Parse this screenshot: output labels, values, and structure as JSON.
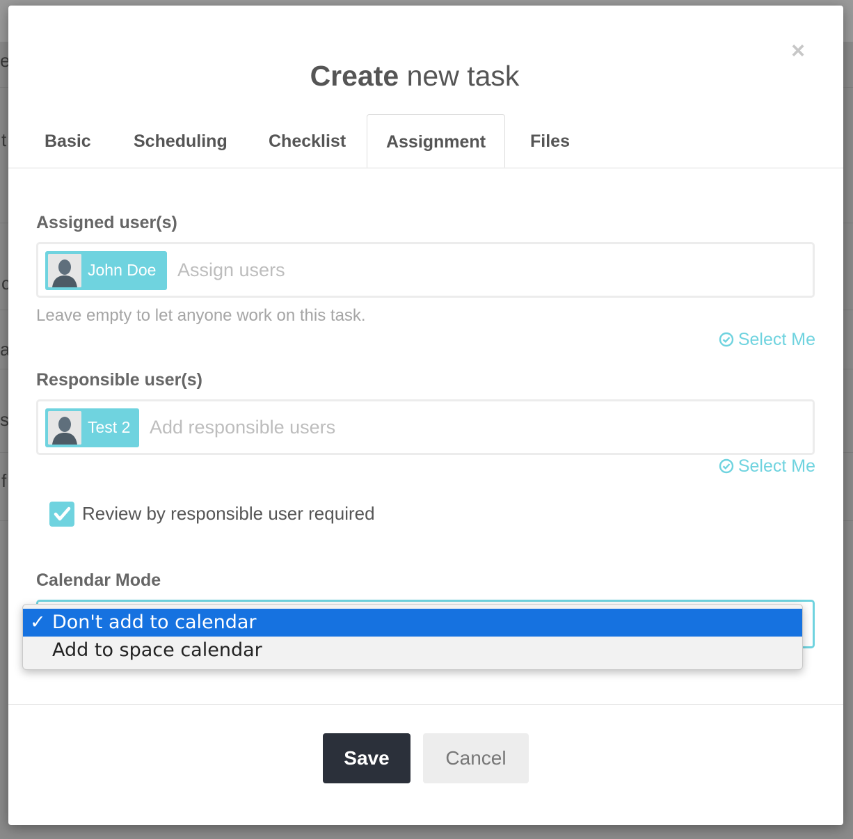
{
  "modal": {
    "title_bold": "Create",
    "title_rest": " new task",
    "close_glyph": "×"
  },
  "tabs": [
    {
      "label": "Basic",
      "active": false
    },
    {
      "label": "Scheduling",
      "active": false
    },
    {
      "label": "Checklist",
      "active": false
    },
    {
      "label": "Assignment",
      "active": true
    },
    {
      "label": "Files",
      "active": false
    }
  ],
  "assigned": {
    "label": "Assigned user(s)",
    "chip": "John Doe",
    "placeholder": "Assign users",
    "hint": "Leave empty to let anyone work on this task.",
    "select_me": "Select Me"
  },
  "responsible": {
    "label": "Responsible user(s)",
    "chip": "Test 2",
    "placeholder": "Add responsible users",
    "select_me": "Select Me"
  },
  "review": {
    "label": "Review by responsible user required",
    "checked": true
  },
  "calendar": {
    "label": "Calendar Mode",
    "options": [
      "Don't add to calendar",
      "Add to space calendar"
    ],
    "selected": "Don't add to calendar",
    "tick": "✓"
  },
  "footer": {
    "save": "Save",
    "cancel": "Cancel"
  },
  "background_fragments": [
    "e",
    "t",
    "c",
    "a",
    "s",
    "f"
  ],
  "colors": {
    "accent": "#6fd3df",
    "dropdown_selected": "#1672e0",
    "save_bg": "#2b303a"
  }
}
